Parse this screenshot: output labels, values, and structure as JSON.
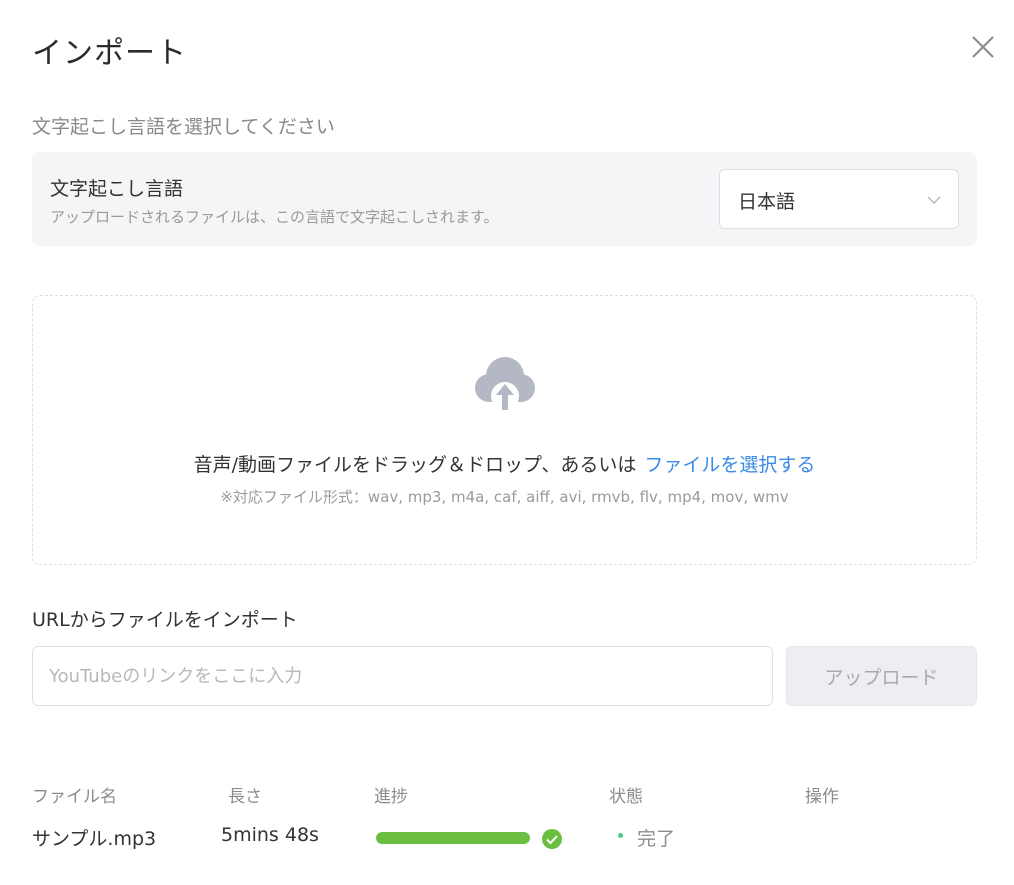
{
  "dialog": {
    "title": "インポート"
  },
  "language": {
    "section_label": "文字起こし言語を選択してください",
    "title": "文字起こし言語",
    "description": "アップロードされるファイルは、この言語で文字起こしされます。",
    "selected": "日本語"
  },
  "dropzone": {
    "text": "音声/動画ファイルをドラッグ＆ドロップ、あるいは",
    "link": "ファイルを選択する",
    "formats": "※対応ファイル形式：wav, mp3, m4a, caf, aiff, avi, rmvb, flv, mp4, mov, wmv"
  },
  "url_import": {
    "label": "URLからファイルをインポート",
    "placeholder": "YouTubeのリンクをここに入力",
    "value": "",
    "button": "アップロード"
  },
  "table": {
    "headers": {
      "name": "ファイル名",
      "duration": "長さ",
      "progress": "進捗",
      "status": "状態",
      "action": "操作"
    },
    "rows": [
      {
        "name": "サンプル.mp3",
        "duration": "5mins 48s",
        "progress": 1.0,
        "status": "完了"
      }
    ]
  },
  "colors": {
    "accent_link": "#3a8be8",
    "progress": "#6abf40",
    "status_dot": "#52c88f"
  },
  "icons": {
    "close": "close-icon",
    "dropdown": "chevron-down-icon",
    "upload": "cloud-upload-icon",
    "complete": "check-circle-icon"
  }
}
